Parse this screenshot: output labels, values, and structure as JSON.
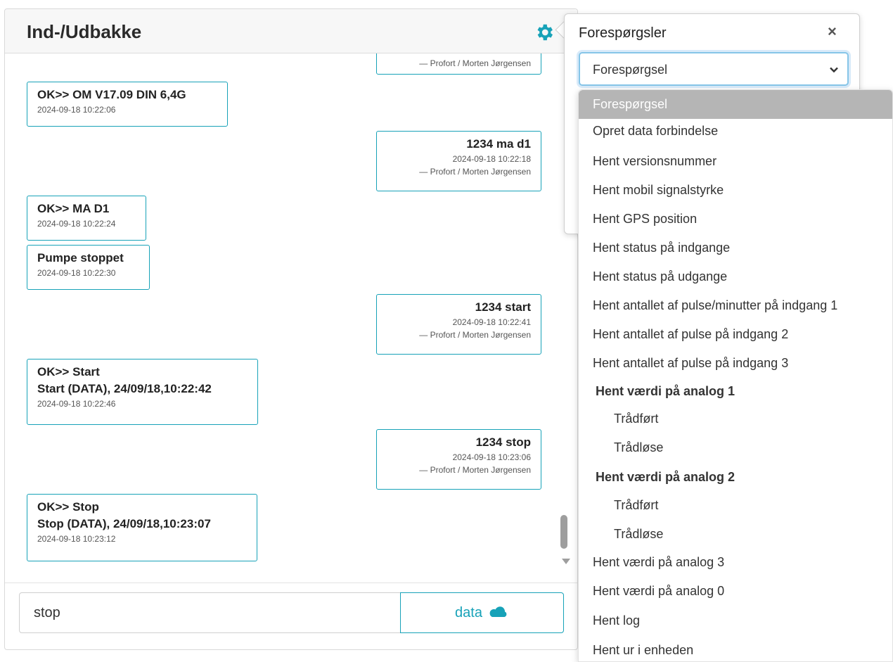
{
  "panel": {
    "title": "Ind-/Udbakke"
  },
  "messages": [
    {
      "dir": "out",
      "lines": [],
      "time": "",
      "author": "— Profort / Morten Jørgensen"
    },
    {
      "dir": "in",
      "lines": [
        "OK>> OM V17.09 DIN 6,4G"
      ],
      "time": "2024-09-18 10:22:06"
    },
    {
      "dir": "out",
      "lines": [
        "1234 ma d1"
      ],
      "time": "2024-09-18 10:22:18",
      "author": "— Profort / Morten Jørgensen"
    },
    {
      "dir": "in",
      "lines": [
        "OK>> MA D1"
      ],
      "time": "2024-09-18 10:22:24"
    },
    {
      "dir": "in",
      "lines": [
        "Pumpe stoppet"
      ],
      "time": "2024-09-18 10:22:30"
    },
    {
      "dir": "out",
      "lines": [
        "1234 start"
      ],
      "time": "2024-09-18 10:22:41",
      "author": "— Profort / Morten Jørgensen"
    },
    {
      "dir": "in",
      "lines": [
        "OK>> Start",
        "Start (DATA), 24/09/18,10:22:42"
      ],
      "time": "2024-09-18 10:22:46"
    },
    {
      "dir": "out",
      "lines": [
        "1234 stop"
      ],
      "time": "2024-09-18 10:23:06",
      "author": "— Profort / Morten Jørgensen"
    },
    {
      "dir": "in",
      "lines": [
        "OK>> Stop",
        "Stop (DATA), 24/09/18,10:23:07"
      ],
      "time": "2024-09-18 10:23:12"
    }
  ],
  "composer": {
    "input_value": "stop",
    "send_label": "data"
  },
  "popover": {
    "title": "Forespørgsler",
    "close": "×",
    "select_value": "Forespørgsel"
  },
  "dropdown": {
    "options": [
      {
        "label": "Forespørgsel",
        "kind": "sel"
      },
      {
        "label": "Opret data forbindelse",
        "kind": "opt"
      },
      {
        "label": "Hent versionsnummer",
        "kind": "opt"
      },
      {
        "label": "Hent mobil signalstyrke",
        "kind": "opt"
      },
      {
        "label": "Hent GPS position",
        "kind": "opt"
      },
      {
        "label": "Hent status på indgange",
        "kind": "opt"
      },
      {
        "label": "Hent status på udgange",
        "kind": "opt"
      },
      {
        "label": "Hent antallet af pulse/minutter på indgang 1",
        "kind": "opt"
      },
      {
        "label": "Hent antallet af pulse på indgang 2",
        "kind": "opt"
      },
      {
        "label": "Hent antallet af pulse på indgang 3",
        "kind": "opt"
      },
      {
        "label": "Hent værdi på analog 1",
        "kind": "group"
      },
      {
        "label": "Trådført",
        "kind": "sub"
      },
      {
        "label": "Trådløse",
        "kind": "sub"
      },
      {
        "label": "Hent værdi på analog 2",
        "kind": "group"
      },
      {
        "label": "Trådført",
        "kind": "sub"
      },
      {
        "label": "Trådløse",
        "kind": "sub"
      },
      {
        "label": "Hent værdi på analog 3",
        "kind": "opt"
      },
      {
        "label": "Hent værdi på analog 0",
        "kind": "opt"
      },
      {
        "label": "Hent log",
        "kind": "opt"
      },
      {
        "label": "Hent ur i enheden",
        "kind": "opt"
      }
    ]
  },
  "colors": {
    "accent": "#17a2b8",
    "selected_option": "#b5b5b5"
  }
}
